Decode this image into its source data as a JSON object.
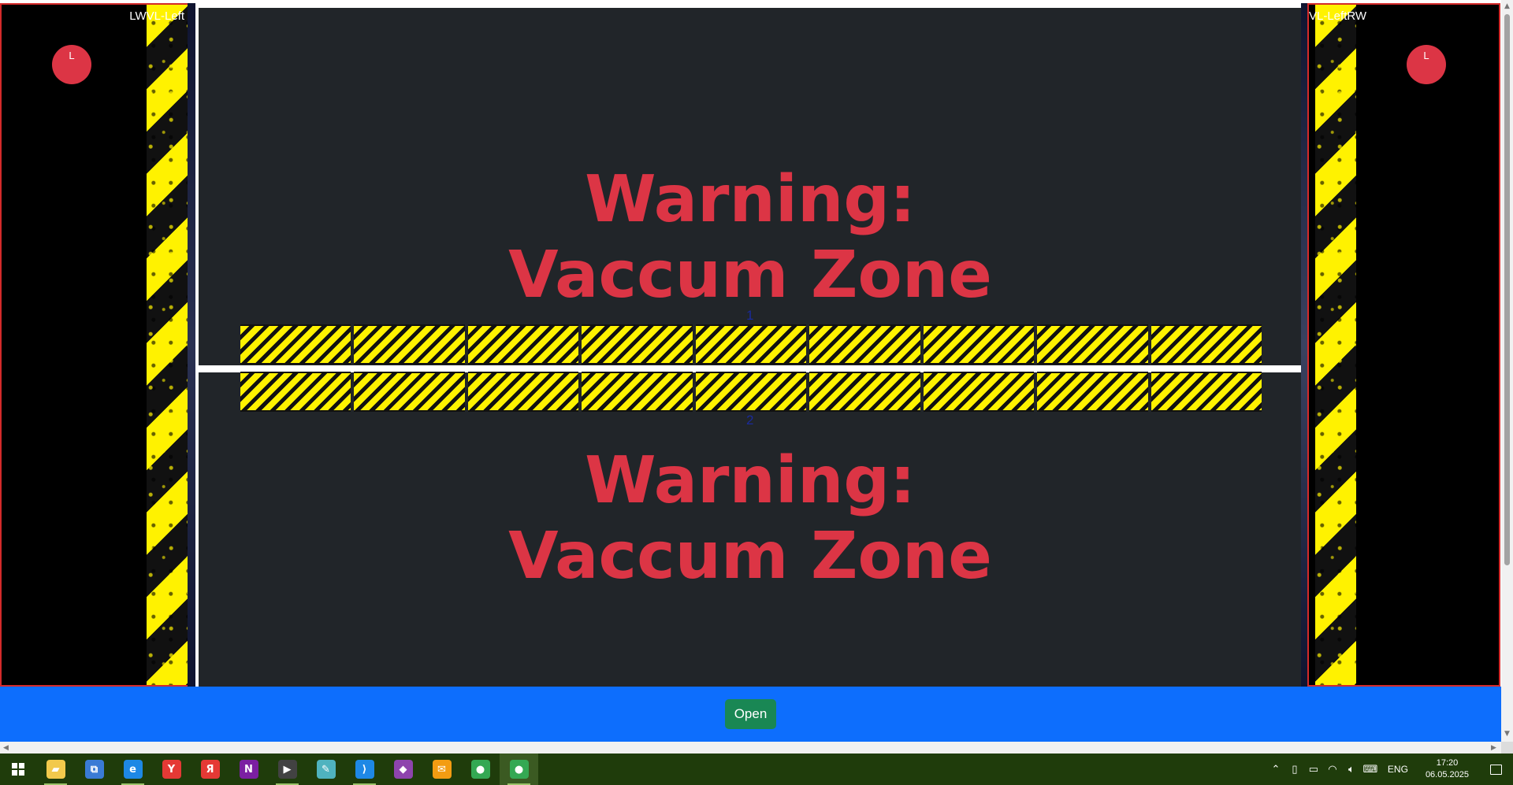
{
  "left_panel": {
    "title": "LWVL-Left",
    "indicator": "L"
  },
  "right_panel": {
    "title": "VL-LeftRW",
    "indicator": "L"
  },
  "zones": [
    {
      "number": "1",
      "warning_line1": "Warning:",
      "warning_line2": "Vaccum Zone"
    },
    {
      "number": "2",
      "warning_line1": "Warning:",
      "warning_line2": "Vaccum Zone"
    }
  ],
  "bottom_bar": {
    "open_label": "Open"
  },
  "colors": {
    "warning_red": "#dc3545",
    "panel_bg": "#212529",
    "bottom_bar_blue": "#0d6efd",
    "open_button_green": "#198754",
    "hazard_yellow": "#fff200",
    "taskbar_bg": "#1f3c0b"
  },
  "taskbar": {
    "apps": [
      {
        "name": "file-explorer-icon",
        "glyph": "▰",
        "color": "#f2c94c",
        "active": true
      },
      {
        "name": "network-app-icon",
        "glyph": "⧉",
        "color": "#3a7bd5",
        "active": false
      },
      {
        "name": "edge-icon",
        "glyph": "e",
        "color": "#1e88e5",
        "active": true
      },
      {
        "name": "yandex-browser-icon",
        "glyph": "Y",
        "color": "#e53935",
        "active": false
      },
      {
        "name": "yandex-icon",
        "glyph": "Я",
        "color": "#e53935",
        "active": false
      },
      {
        "name": "onenote-icon",
        "glyph": "N",
        "color": "#7b1fa2",
        "active": false
      },
      {
        "name": "media-player-icon",
        "glyph": "▶",
        "color": "#424242",
        "active": true
      },
      {
        "name": "notes-app-icon",
        "glyph": "✎",
        "color": "#4fb3bf",
        "active": false
      },
      {
        "name": "vscode-icon",
        "glyph": "⟩",
        "color": "#1e88e5",
        "active": true
      },
      {
        "name": "visual-studio-icon",
        "glyph": "◆",
        "color": "#8e44ad",
        "active": false
      },
      {
        "name": "mail-app-icon",
        "glyph": "✉",
        "color": "#f39c12",
        "active": false
      },
      {
        "name": "chrome-icon",
        "glyph": "●",
        "color": "#34a853",
        "active": false
      },
      {
        "name": "chrome-profile-icon",
        "glyph": "●",
        "color": "#34a853",
        "active": true,
        "current": true
      }
    ],
    "tray": {
      "language": "ENG",
      "time": "17:20",
      "date": "06.05.2025"
    }
  }
}
